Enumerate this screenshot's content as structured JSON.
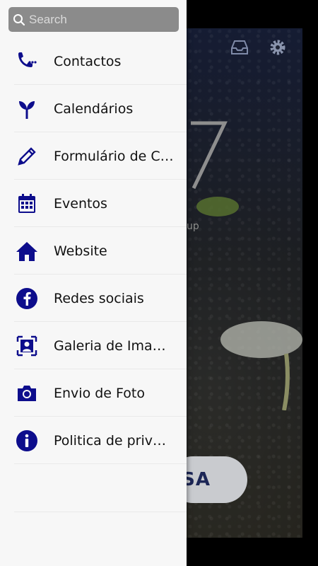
{
  "search": {
    "placeholder": "Search"
  },
  "menu": {
    "items": [
      {
        "label": "Contactos",
        "icon": "phone-icon"
      },
      {
        "label": "Calendários",
        "icon": "sprout-icon"
      },
      {
        "label": "Formulário de Contacto",
        "icon": "pencil-icon"
      },
      {
        "label": "Eventos",
        "icon": "calendar-icon"
      },
      {
        "label": "Website",
        "icon": "home-icon"
      },
      {
        "label": "Redes sociais",
        "icon": "facebook-icon"
      },
      {
        "label": "Galeria de Imagens",
        "icon": "portrait-icon"
      },
      {
        "label": "Envio de Foto",
        "icon": "camera-icon"
      },
      {
        "label": "Politica de privacidade",
        "icon": "info-icon"
      }
    ]
  },
  "background": {
    "logo_fragment": "up",
    "button_fragment": "SA",
    "icons": [
      "inbox-icon",
      "gear-icon"
    ]
  },
  "colors": {
    "icon_navy": "#0d0d8c",
    "drawer_bg": "#f7f7f7",
    "search_bg": "#8b8b8b"
  }
}
